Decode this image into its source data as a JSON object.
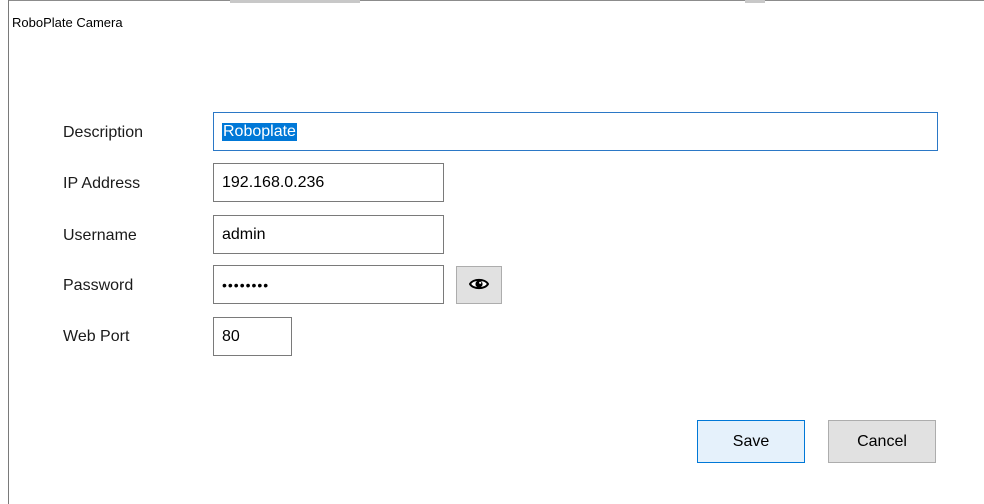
{
  "window": {
    "title": "RoboPlate Camera"
  },
  "form": {
    "description": {
      "label": "Description",
      "value": "Roboplate"
    },
    "ip_address": {
      "label": "IP Address",
      "value": "192.168.0.236"
    },
    "username": {
      "label": "Username",
      "value": "admin"
    },
    "password": {
      "label": "Password",
      "value": "••••••••",
      "toggle_icon": "eye-icon"
    },
    "web_port": {
      "label": "Web Port",
      "value": "80"
    }
  },
  "buttons": {
    "save_label": "Save",
    "cancel_label": "Cancel"
  },
  "colors": {
    "selection": "#0078d7",
    "focus_border": "#2b78c6",
    "save_bg": "#e5f1fb",
    "button_bg": "#e1e1e1"
  }
}
